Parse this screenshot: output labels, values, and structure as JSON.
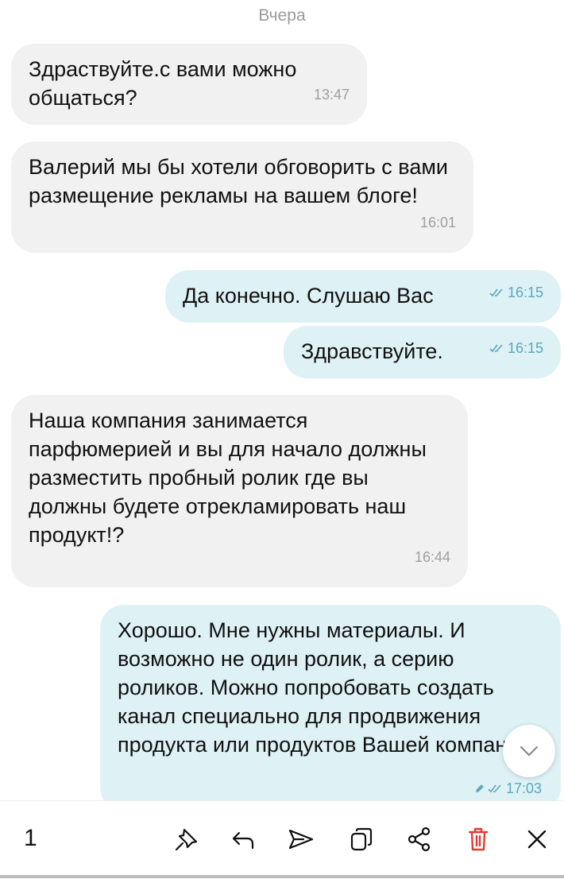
{
  "day_separator": "Вчера",
  "messages": [
    {
      "direction": "in",
      "text": "Здраствуйте.с вами можно общаться?",
      "time": "13:47"
    },
    {
      "direction": "in",
      "text": "Валерий мы бы хотели обговорить с вами размещение рекламы на вашем блоге!",
      "time": "16:01"
    },
    {
      "direction": "out",
      "text": "Да конечно. Слушаю Вас",
      "time": "16:15",
      "status": "read"
    },
    {
      "direction": "out",
      "text": "Здравствуйте.",
      "time": "16:15",
      "status": "read"
    },
    {
      "direction": "in",
      "text": "Наша компания занимается парфюмерией и вы для начало должны разместить пробный ролик где вы должны будете отрекламировать наш продукт!?",
      "time": "16:44"
    },
    {
      "direction": "out",
      "text": "Хорошо. Мне нужны материалы. И возможно не один ролик, а серию роликов. Можно попробовать создать канал специально для продвижения продукта или продуктов Вашей компании.",
      "time": "17:03",
      "status": "read",
      "edited": true
    }
  ],
  "selection": {
    "count": "1"
  },
  "toolbar": {
    "actions": [
      "pin",
      "reply",
      "forward",
      "copy",
      "share",
      "delete",
      "close"
    ]
  },
  "colors": {
    "incoming_bubble": "#f1f1f1",
    "outgoing_bubble": "#def1f5",
    "outgoing_meta": "#58a8c0",
    "delete_red": "#e53935"
  }
}
